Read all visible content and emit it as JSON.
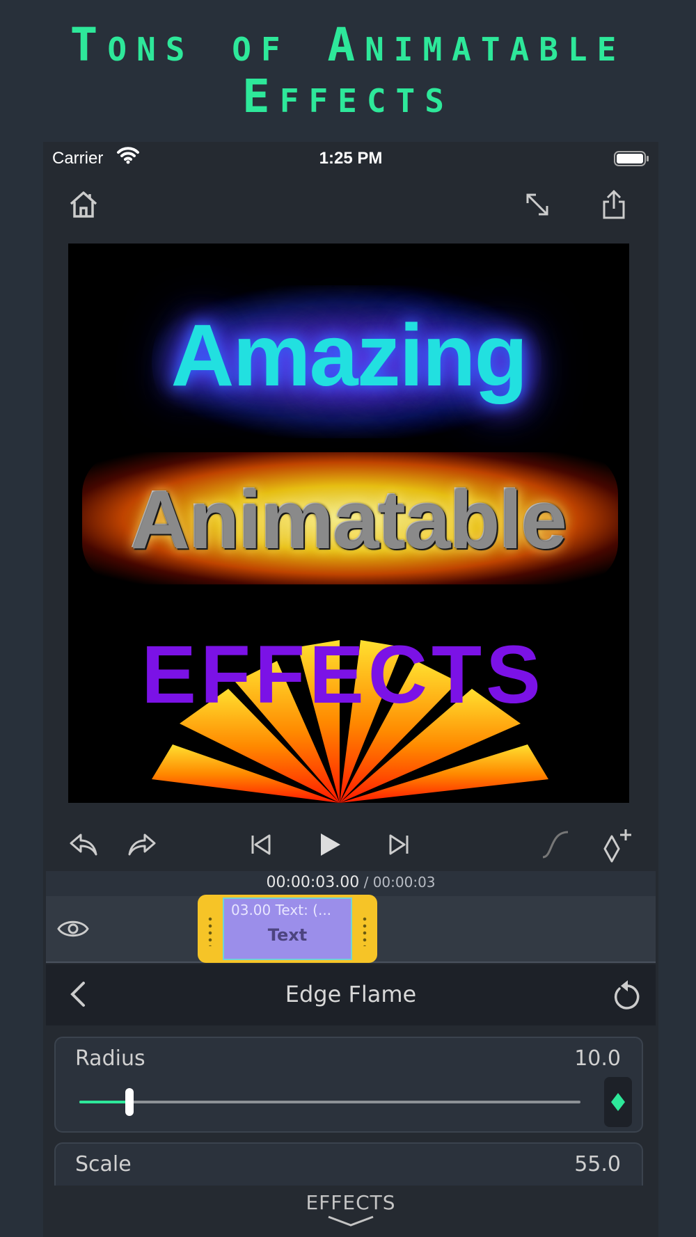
{
  "hero": {
    "title_line1": "Tons of Animatable",
    "title_line2": "Effects"
  },
  "statusbar": {
    "carrier": "Carrier",
    "time": "1:25 PM"
  },
  "preview": {
    "line1": "Amazing",
    "line2": "Animatable",
    "line3": "EFFECTS"
  },
  "timeline": {
    "current_time": "00:00:03.00",
    "separator": " / ",
    "total_time": "00:00:03"
  },
  "clip": {
    "meta": "03.00  Text: (...",
    "label": "Text"
  },
  "panel": {
    "title": "Edge Flame"
  },
  "params": [
    {
      "name": "Radius",
      "value": "10.0",
      "level": 0.1
    },
    {
      "name": "Scale",
      "value": "55.0"
    }
  ],
  "bottom": {
    "label": "EFFECTS"
  },
  "colors": {
    "accent": "#2ee89a",
    "clip": "#f6c427",
    "clip_body": "#9b8eea",
    "background": "#28303a"
  }
}
